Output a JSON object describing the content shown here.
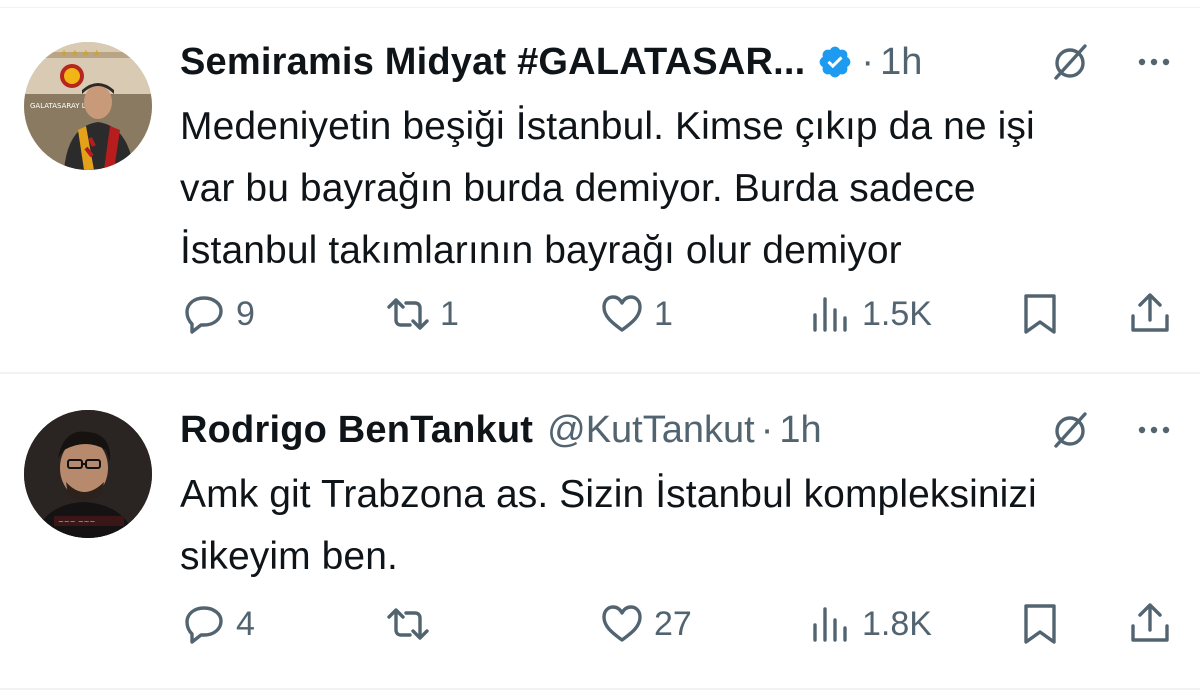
{
  "tweets": [
    {
      "author_name": "Semiramis Midyat #GALATASAR...",
      "handle": "",
      "dot": "·",
      "time": "1h",
      "text_lines": [
        "Medeniyetin beşiği İstanbul. Kimse çıkıp da ne işi",
        "var bu bayrağın burda demiyor. Burda sadece",
        "İstanbul takımlarının bayrağı olur demiyor"
      ],
      "replies": "9",
      "retweets": "1",
      "likes": "1",
      "views": "1.5K",
      "verified": true,
      "avatar_text": "GALATASARAY LİSESİ"
    },
    {
      "author_name": "Rodrigo BenTankut",
      "handle": "@KutTankut",
      "dot": "·",
      "time": "1h",
      "text_lines": [
        "Amk git Trabzona as. Sizin İstanbul kompleksinizi",
        "sikeyim ben."
      ],
      "replies": "4",
      "retweets": "",
      "likes": "27",
      "views": "1.8K",
      "verified": false
    }
  ],
  "colors": {
    "text": "#0f1419",
    "secondary": "#536471",
    "verified": "#1d9bf0",
    "divider": "#eff3f4"
  },
  "icons": [
    "verified-badge-icon",
    "grok-icon",
    "more-icon",
    "reply-icon",
    "retweet-icon",
    "like-icon",
    "views-icon",
    "bookmark-icon",
    "share-icon"
  ]
}
